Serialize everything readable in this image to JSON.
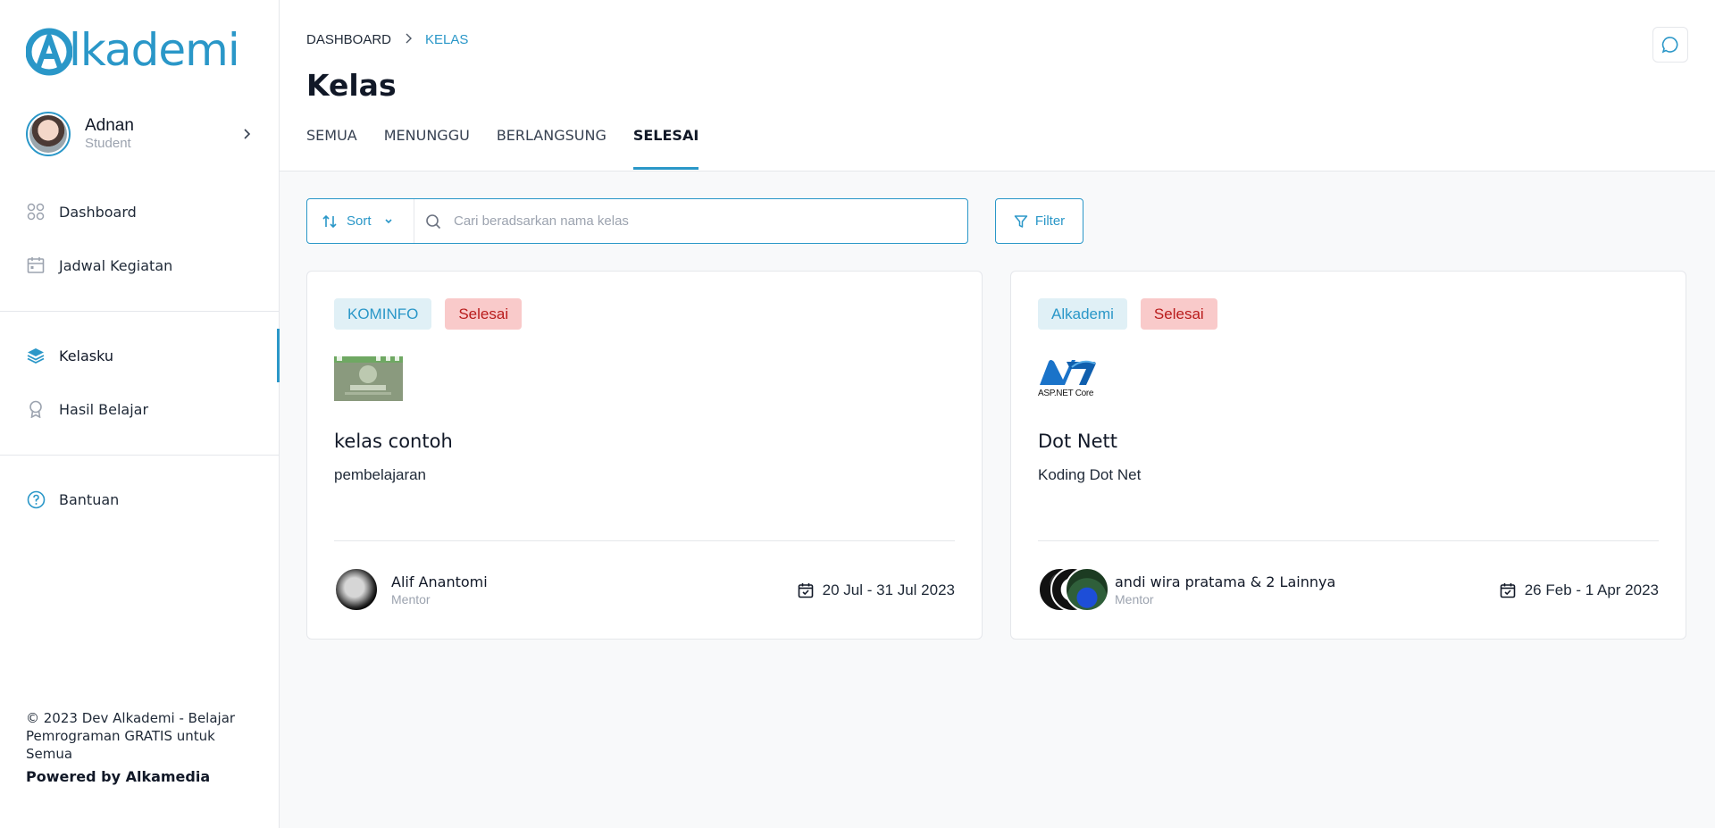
{
  "brand": {
    "logo_text": "lkademi",
    "accent": "#2a97c8"
  },
  "profile": {
    "name": "Adnan",
    "role": "Student"
  },
  "nav": {
    "group1": [
      {
        "label": "Dashboard",
        "icon": "grid-icon"
      },
      {
        "label": "Jadwal Kegiatan",
        "icon": "calendar-icon"
      }
    ],
    "group2": [
      {
        "label": "Kelasku",
        "icon": "layers-icon",
        "active": true
      },
      {
        "label": "Hasil Belajar",
        "icon": "award-icon"
      }
    ],
    "group3": [
      {
        "label": "Bantuan",
        "icon": "help-circle-icon"
      }
    ]
  },
  "footer": {
    "copyright": "© 2023 Dev Alkademi - Belajar Pemrograman GRATIS untuk Semua",
    "powered": "Powered by Alkamedia"
  },
  "breadcrumb": {
    "home": "DASHBOARD",
    "current": "KELAS"
  },
  "page_title": "Kelas",
  "tabs": [
    {
      "label": "SEMUA"
    },
    {
      "label": "MENUNGGU"
    },
    {
      "label": "BERLANGSUNG"
    },
    {
      "label": "SELESAI",
      "active": true
    }
  ],
  "toolbar": {
    "sort_label": "Sort",
    "search_placeholder": "Cari beradsarkan nama kelas",
    "filter_label": "Filter"
  },
  "cards": [
    {
      "org": "KOMINFO",
      "status": "Selesai",
      "title": "kelas contoh",
      "description": "pembelajaran",
      "mentor_name": "Alif Anantomi",
      "mentor_role": "Mentor",
      "date_range": "20 Jul - 31 Jul 2023"
    },
    {
      "org": "Alkademi",
      "status": "Selesai",
      "thumb_text": "ASP.NET Core",
      "title": "Dot Nett",
      "description": "Koding Dot Net",
      "mentor_name": "andi wira pratama & 2 Lainnya",
      "mentor_role": "Mentor",
      "date_range": "26 Feb - 1 Apr 2023"
    }
  ]
}
